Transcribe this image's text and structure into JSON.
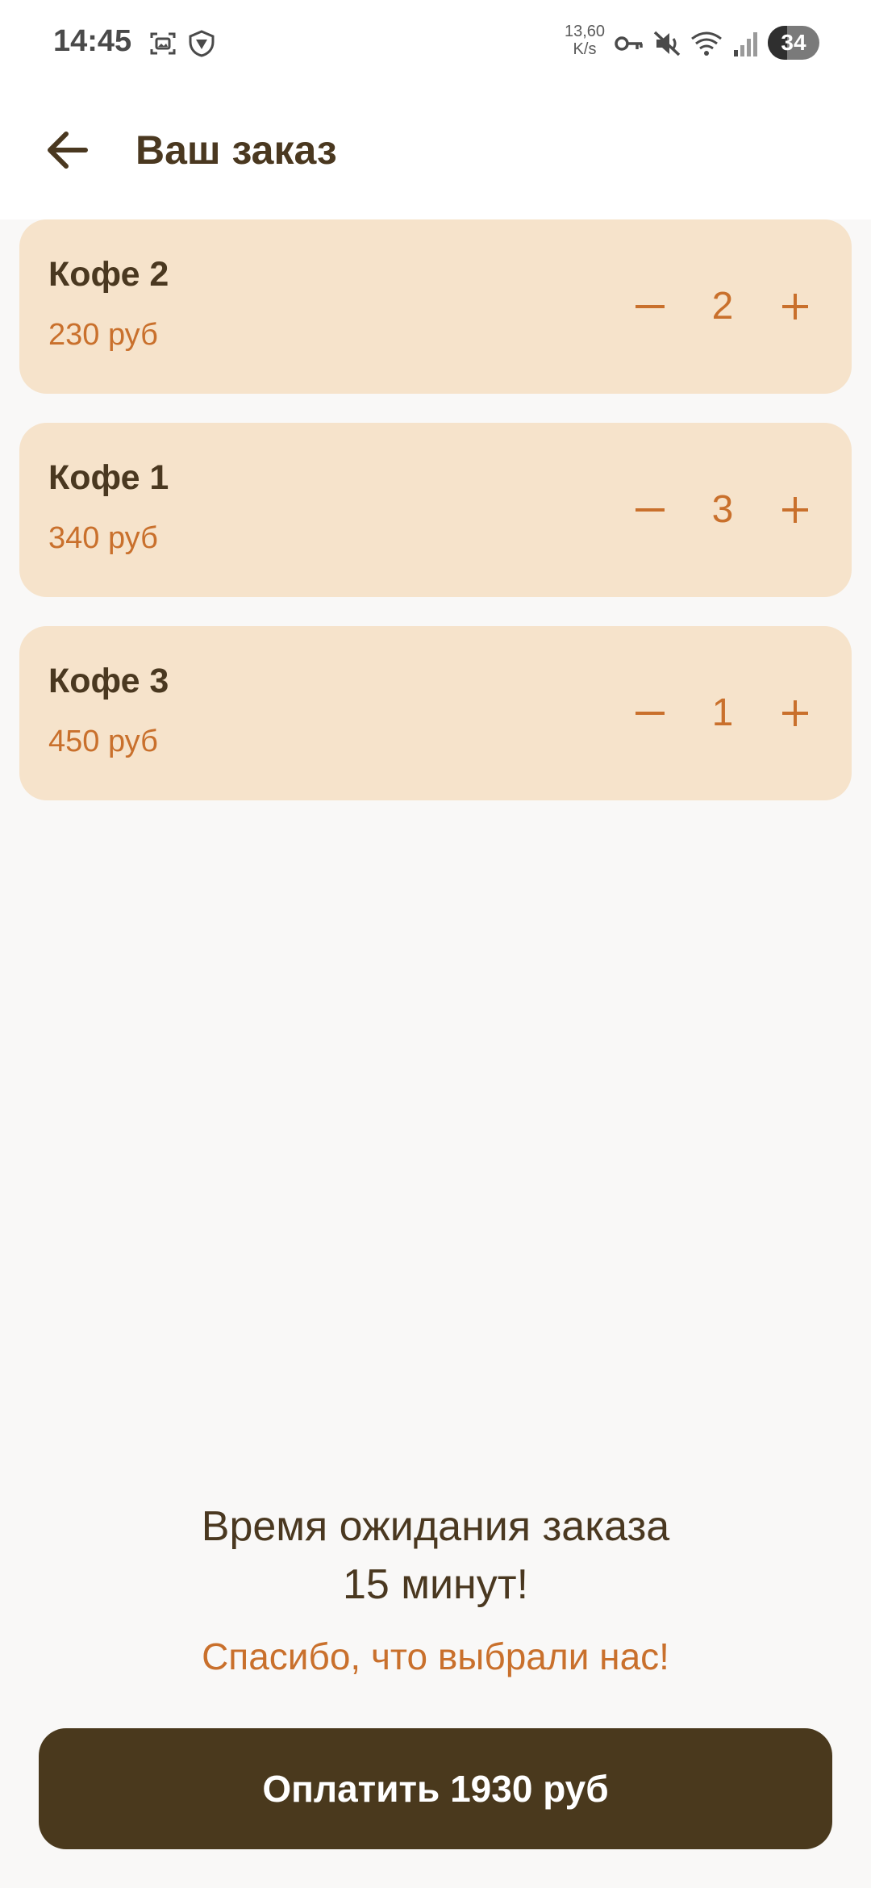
{
  "status_bar": {
    "time": "14:45",
    "speed_value": "13,60",
    "speed_unit": "K/s",
    "battery_level": "34",
    "icons": [
      "screenshot-icon",
      "vpn-shield-icon",
      "key-icon",
      "mute-icon",
      "wifi-icon",
      "signal-icon"
    ]
  },
  "app_bar": {
    "title": "Ваш заказ",
    "back_icon": "arrow-left-icon"
  },
  "order_items": [
    {
      "name": "Кофе 2",
      "price": "230 руб",
      "quantity": "2"
    },
    {
      "name": "Кофе 1",
      "price": "340 руб",
      "quantity": "3"
    },
    {
      "name": "Кофе 3",
      "price": "450 руб",
      "quantity": "1"
    }
  ],
  "wait_message": {
    "line1": "Время ожидания заказа",
    "line2": "15 минут!"
  },
  "thanks_message": "Спасибо, что выбрали нас!",
  "pay_button_label": "Оплатить 1930 руб",
  "colors": {
    "primary_dark": "#4a391d",
    "accent": "#c9702c",
    "card_background": "#f6e3cb",
    "title_text": "#4a3820",
    "page_background": "#f9f8f7"
  }
}
